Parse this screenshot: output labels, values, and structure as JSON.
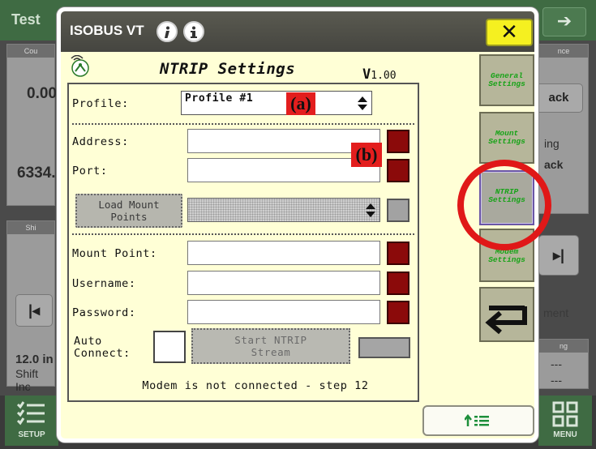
{
  "background": {
    "title": "Test",
    "panel_headers": [
      "Cou",
      "Shi",
      "nce",
      "ng"
    ],
    "values": [
      "0.00",
      "6334.",
      "12.0 in",
      "Shift Inc"
    ],
    "right_text": [
      "ack",
      "ing",
      "ack",
      "ment",
      "---",
      "---"
    ],
    "bottom": {
      "setup_label": "SETUP",
      "menu_label": "MENU"
    }
  },
  "dialog": {
    "title": "ISOBUS VT",
    "close_label": "✕",
    "page_title": "NTRIP Settings",
    "version_prefix": "V",
    "version_number": "1.00",
    "profile": {
      "label": "Profile:",
      "value": "Profile #1"
    },
    "annotations": {
      "a": "(a)",
      "b": "(b)"
    },
    "address": {
      "label": "Address:",
      "value": ""
    },
    "port": {
      "label": "Port:",
      "value": ""
    },
    "load_mount_points_label": "Load Mount\nPoints",
    "mount_point": {
      "label": "Mount Point:",
      "value": ""
    },
    "username": {
      "label": "Username:",
      "value": ""
    },
    "password": {
      "label": "Password:",
      "value": ""
    },
    "auto_connect_label": "Auto\nConnect:",
    "start_stream_label": "Start NTRIP\nStream",
    "status_message": "Modem is not connected - step 12",
    "side_tabs": [
      {
        "label": "General\nSettings"
      },
      {
        "label": "Mount\nSettings"
      },
      {
        "label": "NTRIP\nSettings"
      },
      {
        "label": "Modem\nSettings"
      }
    ],
    "colors": {
      "indicator_red": "#8b0a0a",
      "tab_text_green": "#17a317",
      "highlight_red": "#e01818",
      "close_yellow": "#f5f020"
    }
  }
}
